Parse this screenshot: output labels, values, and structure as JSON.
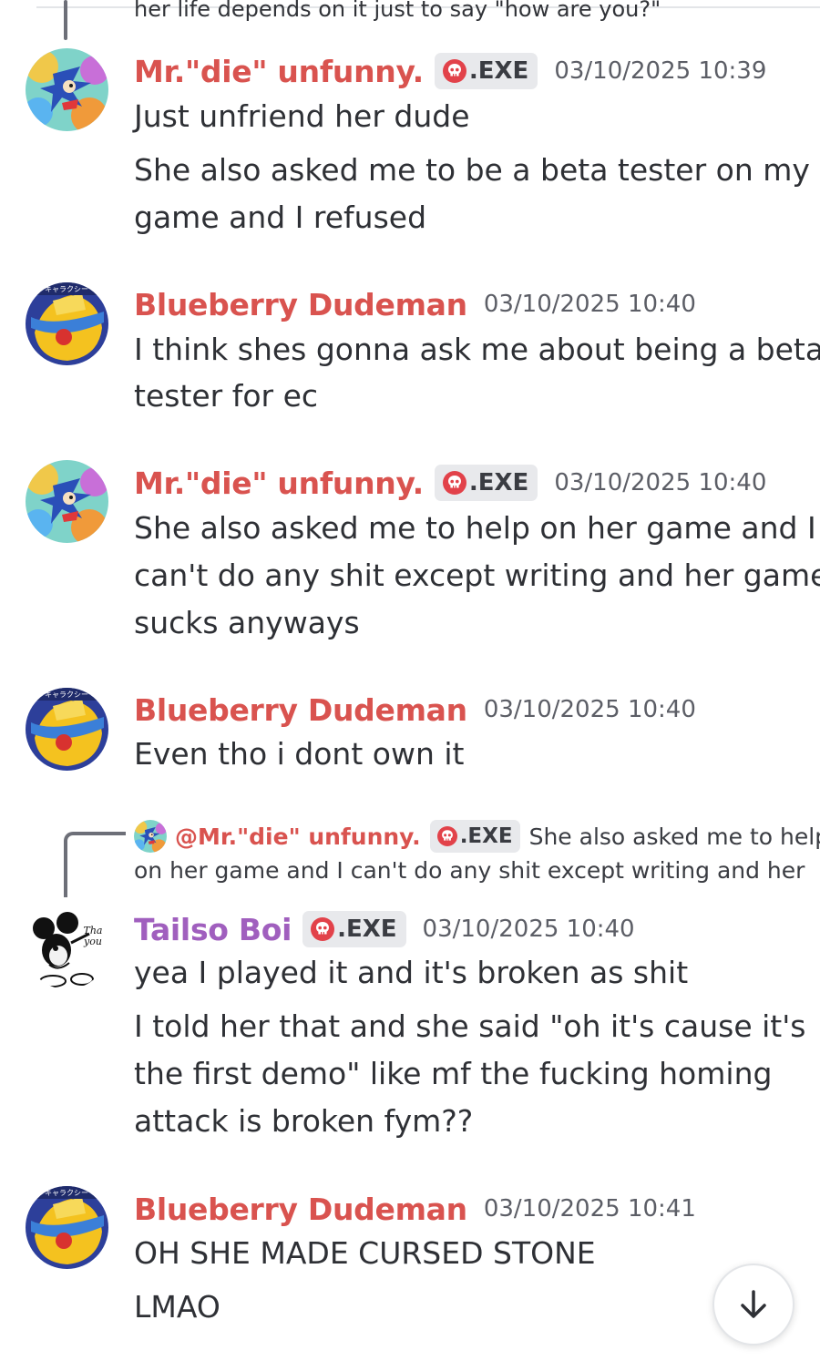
{
  "cut_message": {
    "text": "her life depends on it just to say \"how are you?\""
  },
  "messages": [
    {
      "author": "Mr.\"die\" unfunny.",
      "tag": ".EXE",
      "time": "03/10/2025 10:39",
      "lines": [
        "Just unfriend her dude",
        "She also asked me to be a beta tester on my",
        "game and I refused"
      ]
    },
    {
      "author": "Blueberry Dudeman",
      "time": "03/10/2025 10:40",
      "lines": [
        "I think shes gonna ask me about being a beta",
        "tester for ec"
      ]
    },
    {
      "author": "Mr.\"die\" unfunny.",
      "tag": ".EXE",
      "time": "03/10/2025 10:40",
      "lines": [
        "She also asked me to help on her game and I",
        "can't do any shit except writing and her game",
        "sucks anyways"
      ]
    },
    {
      "author": "Blueberry Dudeman",
      "time": "03/10/2025 10:40",
      "lines": [
        "Even tho i dont own it"
      ]
    },
    {
      "reply": {
        "author": "@Mr.\"die\" unfunny.",
        "tag": ".EXE",
        "text": "She also asked me to help",
        "text2": "on her game and I can't do any shit except writing and her"
      },
      "author": "Tailso Boi",
      "tag": ".EXE",
      "time": "03/10/2025 10:40",
      "lines": [
        "yea I played it and it's broken as shit",
        "I told her that and she said \"oh it's cause it's",
        "the first demo\" like mf the fucking homing",
        "attack is broken fym??"
      ]
    },
    {
      "author": "Blueberry Dudeman",
      "time": "03/10/2025 10:41",
      "lines": [
        "OH SHE MADE CURSED STONE",
        "LMAO"
      ]
    }
  ],
  "colors": {
    "author_red": "#d9534f",
    "author_purple": "#a05fbe",
    "tag_bg": "#e8e9ec"
  },
  "icons": {
    "jump": "arrow-down-icon",
    "badge": "skull-icon"
  }
}
